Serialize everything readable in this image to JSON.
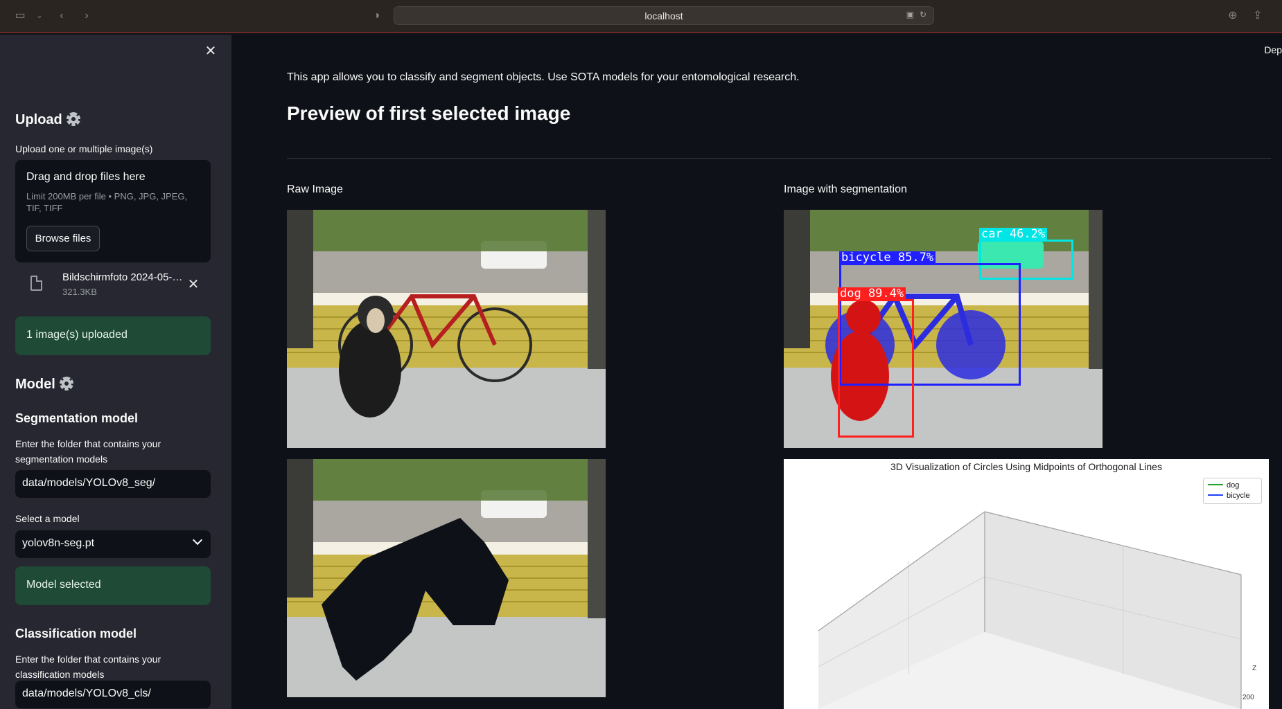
{
  "browser": {
    "url": "localhost"
  },
  "sidebar": {
    "upload": {
      "heading": "Upload",
      "label": "Upload one or multiple image(s)",
      "dropzone_title": "Drag and drop files here",
      "dropzone_limit": "Limit 200MB per file • PNG, JPG, JPEG, TIF, TIFF",
      "browse_label": "Browse files",
      "file_name": "Bildschirmfoto 2024-05-…",
      "file_size": "321.3KB",
      "status": "1 image(s) uploaded"
    },
    "model": {
      "heading": "Model",
      "segmentation_heading": "Segmentation model",
      "seg_folder_label": "Enter the folder that contains your segmentation models",
      "seg_folder_value": "data/models/YOLOv8_seg/",
      "select_label": "Select a model",
      "select_value": "yolov8n-seg.pt",
      "status": "Model selected",
      "classification_heading": "Classification model",
      "cls_folder_label": "Enter the folder that contains your classification models",
      "cls_folder_value": "data/models/YOLOv8_cls/"
    }
  },
  "main": {
    "deploy_label": "Dep",
    "intro": "This app allows you to classify and segment objects. Use SOTA models for your entomological research.",
    "preview_heading": "Preview of first selected image",
    "raw_caption": "Raw Image",
    "seg_caption": "Image with segmentation",
    "detections": [
      {
        "label": "car 46.2%",
        "color": "#00e5e5"
      },
      {
        "label": "bicycle 85.7%",
        "color": "#1f1fff"
      },
      {
        "label": "dog 89.4%",
        "color": "#ff1f1f"
      }
    ],
    "plot": {
      "title": "3D Visualization of Circles Using Midpoints of Orthogonal Lines",
      "legend": [
        {
          "name": "dog",
          "color": "#2ca02c"
        },
        {
          "name": "bicycle",
          "color": "#1f3fff"
        }
      ],
      "axis_label": "Z",
      "tick": "200"
    }
  }
}
